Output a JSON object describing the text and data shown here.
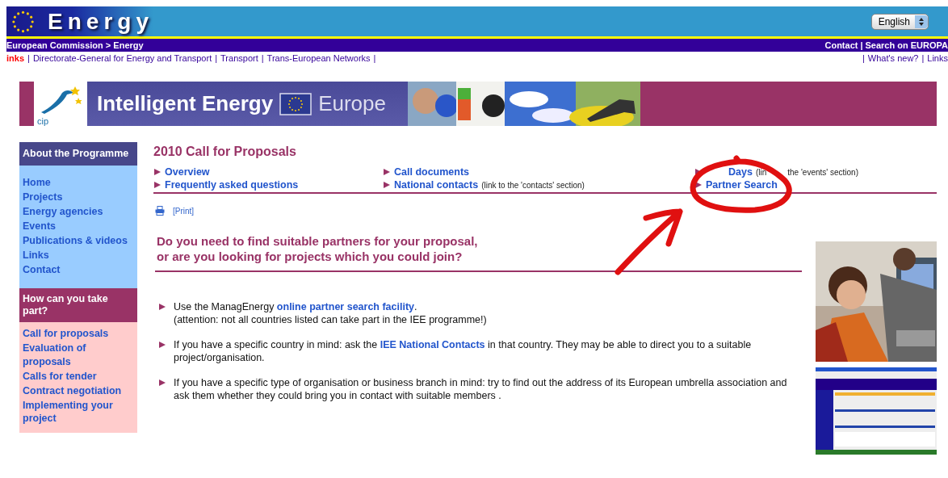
{
  "header": {
    "title": "Energy",
    "language": "English"
  },
  "breadcrumb": {
    "left": "European Commission > Energy",
    "right": [
      {
        "text": "Contact"
      },
      {
        "text": "Search on EUROPA"
      }
    ],
    "separator": "|"
  },
  "links_bar": {
    "separator": "|",
    "left": [
      {
        "text": "inks",
        "color": "#ff0000"
      },
      {
        "text": "Directorate-General for Energy and Transport",
        "color": "#330099"
      },
      {
        "text": "Transport",
        "color": "#330099"
      },
      {
        "text": "Trans-European Networks",
        "color": "#330099"
      }
    ],
    "right": [
      {
        "text": "What's new?"
      },
      {
        "text": "Links"
      }
    ]
  },
  "banner": {
    "logo": "cip",
    "title": "Intelligent Energy",
    "subtitle": "Europe"
  },
  "sidebar": [
    {
      "heading": "About the Programme",
      "kind": "about",
      "items": [
        "Home",
        "Projects",
        "Energy agencies",
        "Events",
        "Publications & videos",
        "Links",
        "Contact"
      ]
    },
    {
      "heading": "How can you take part?",
      "kind": "take-part",
      "items": [
        "Call for proposals",
        "Evaluation of proposals",
        "Calls for tender",
        "Contract negotiation",
        "Implementing your project"
      ]
    }
  ],
  "main": {
    "title": "2010 Call for Proposals",
    "nav": [
      [
        {
          "label": "Overview"
        },
        {
          "label": "Frequently asked questions"
        }
      ],
      [
        {
          "label": "Call documents"
        },
        {
          "label": "National contacts",
          "note": "(link to the 'contacts' section)"
        }
      ],
      [
        {
          "label": "Days",
          "covered": true,
          "note": "(lin",
          "note_after_gap": "the 'events' section)"
        },
        {
          "label": "Partner Search"
        }
      ]
    ],
    "print": "[Print]",
    "question": [
      "Do you need to find suitable partners for your proposal,",
      "or are you looking for projects which you could join?"
    ],
    "bullets": [
      {
        "before": "Use the ManagEnergy ",
        "link": "online partner search facility",
        "after": ".",
        "note": "(attention: not all countries listed can take part in the IEE programme!)"
      },
      {
        "before": "If you have a specific country in mind: ask the ",
        "link": "IEE National Contacts",
        "after": " in that country. They may be able to direct you to a suitable project/organisation."
      },
      {
        "before": "If you have a specific type of organisation or business branch in mind: try to find out the address of its  European umbrella association and ask them whether they could bring you in contact with suitable members ."
      }
    ]
  }
}
